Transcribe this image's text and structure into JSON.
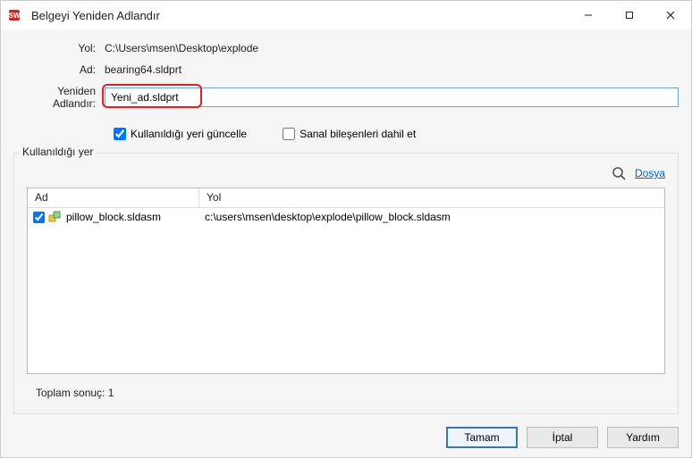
{
  "window": {
    "title": "Belgeyi Yeniden Adlandır"
  },
  "form": {
    "path_label": "Yol:",
    "path_value": "C:\\Users\\msen\\Desktop\\explode",
    "name_label": "Ad:",
    "name_value": "bearing64.sldprt",
    "rename_label": "Yeniden Adlandır:",
    "rename_value": "Yeni_ad.sldprt"
  },
  "checks": {
    "update_used": "Kullanıldığı yeri güncelle",
    "update_used_checked": true,
    "include_virtual": "Sanal bileşenleri dahil et",
    "include_virtual_checked": false
  },
  "usage": {
    "legend": "Kullanıldığı yer",
    "file_link": "Dosya",
    "headers": {
      "name": "Ad",
      "path": "Yol"
    },
    "rows": [
      {
        "checked": true,
        "name": "pillow_block.sldasm",
        "path": "c:\\users\\msen\\desktop\\explode\\pillow_block.sldasm"
      }
    ],
    "total_label": "Toplam sonuç:",
    "total_count": "1"
  },
  "buttons": {
    "ok": "Tamam",
    "cancel": "İptal",
    "help": "Yardım"
  }
}
